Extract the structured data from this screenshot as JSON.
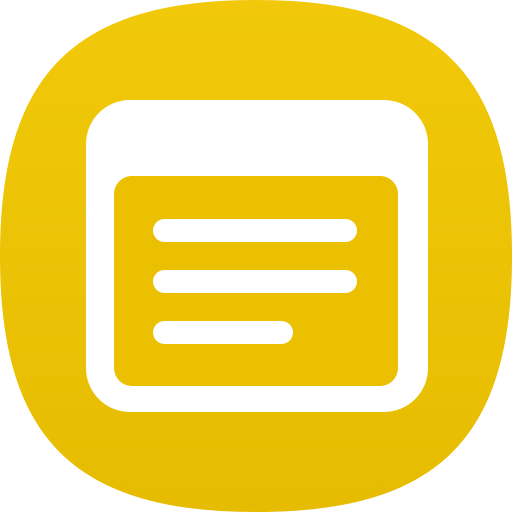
{
  "app_icon": {
    "name": "notes-icon",
    "colors": {
      "background": "#ffffff",
      "tile_top": "#F1C90A",
      "tile_bottom": "#E6BC00",
      "panel": "#FFFFFF",
      "card": "#EBC000",
      "lines": "#FFFFFF"
    }
  }
}
